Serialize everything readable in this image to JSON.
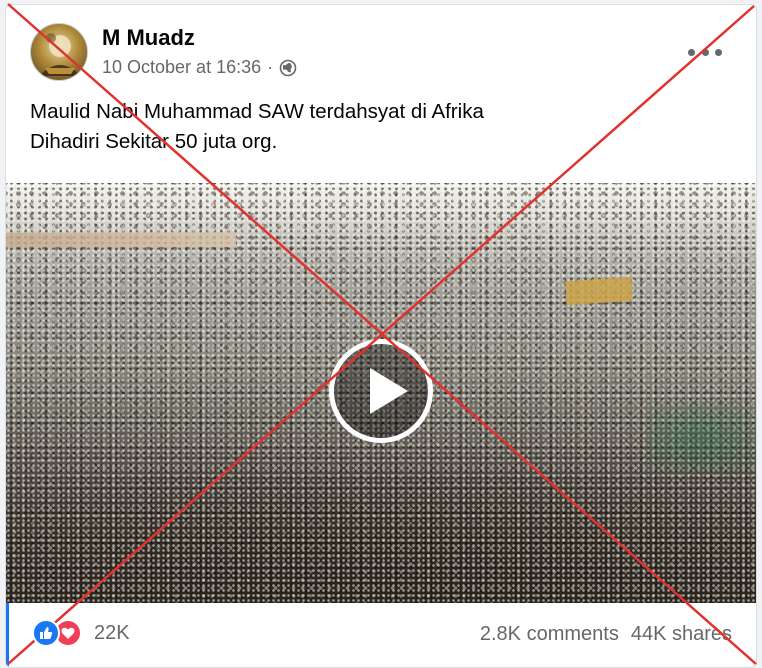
{
  "post": {
    "author": "M Muadz",
    "timestamp": "10 October at 16:36",
    "separator": "·",
    "privacy_icon": "globe-icon",
    "text_lines": [
      "Maulid Nabi Muhammad SAW terdahsyat di Afrika",
      "Dihadiri Sekitar 50 juta org."
    ]
  },
  "video": {
    "play_icon": "play-icon"
  },
  "engagement": {
    "reaction_icons": [
      "like-icon",
      "love-icon"
    ],
    "reaction_count": "22K",
    "comments": "2.8K comments",
    "shares": "44K shares"
  },
  "colors": {
    "cross_red": "#e0322f",
    "facebook_blue": "#1877f2",
    "love_red": "#f33e58",
    "meta_gray": "#65676b"
  }
}
